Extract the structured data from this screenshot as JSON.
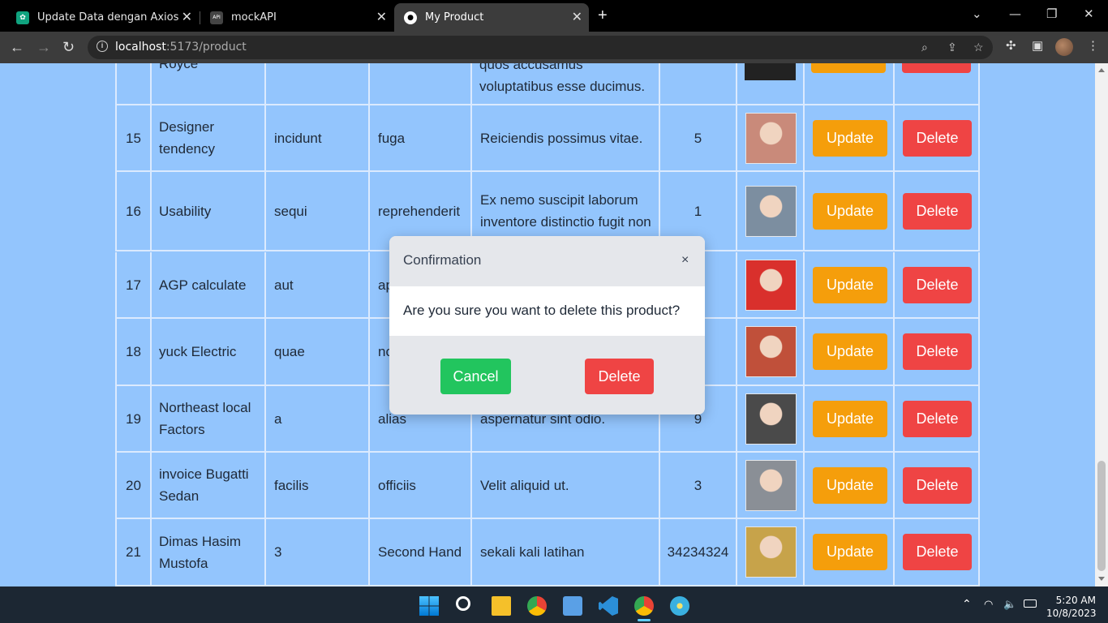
{
  "browser": {
    "tabs": [
      {
        "title": "Update Data dengan Axios",
        "icon": "chatgpt-icon"
      },
      {
        "title": "mockAPI",
        "icon": "mockapi-icon"
      },
      {
        "title": "My Product",
        "icon": "github-icon"
      }
    ],
    "url_host": "localhost",
    "url_path": ":5173/product"
  },
  "table": {
    "partial_row": {
      "name": "Royce",
      "description": "quos accusamus voluptatibus esse ducimus."
    },
    "rows": [
      {
        "id": "15",
        "name": "Designer tendency",
        "category": "incidunt",
        "freshness": "fuga",
        "description": "Reiciendis possimus vitae.",
        "price": "5",
        "image_color": "#c98a7a"
      },
      {
        "id": "16",
        "name": "Usability",
        "category": "sequi",
        "freshness": "reprehenderit",
        "description": "Ex nemo suscipit laborum inventore distinctio fugit non",
        "price": "1",
        "image_color": "#7c8ea0"
      },
      {
        "id": "17",
        "name": "AGP calculate",
        "category": "aut",
        "freshness": "ap",
        "description": "",
        "price": "",
        "image_color": "#d9302c"
      },
      {
        "id": "18",
        "name": "yuck Electric",
        "category": "quae",
        "freshness": "nc",
        "description": "",
        "price": "",
        "image_color": "#c0503a"
      },
      {
        "id": "19",
        "name": "Northeast local Factors",
        "category": "a",
        "freshness": "alias",
        "description": "aspernatur sint odio.",
        "price": "9",
        "image_color": "#4a4a4a"
      },
      {
        "id": "20",
        "name": "invoice Bugatti Sedan",
        "category": "facilis",
        "freshness": "officiis",
        "description": "Velit aliquid ut.",
        "price": "3",
        "image_color": "#8a8f96"
      },
      {
        "id": "21",
        "name": "Dimas Hasim Mustofa",
        "category": "3",
        "freshness": "Second Hand",
        "description": "sekali kali latihan",
        "price": "34234324",
        "image_color": "#c7a34a"
      }
    ],
    "update_label": "Update",
    "delete_label": "Delete"
  },
  "modal": {
    "title": "Confirmation",
    "close": "×",
    "message": "Are you sure you want to delete this product?",
    "cancel_label": "Cancel",
    "delete_label": "Delete"
  },
  "taskbar": {
    "apps": [
      "windows-start-icon",
      "search-icon",
      "file-explorer-icon",
      "chrome-icon",
      "notepad-icon",
      "vscode-icon",
      "chrome-profile-icon",
      "paint-icon"
    ],
    "time": "5:20 AM",
    "date": "10/8/2023"
  },
  "colors": {
    "page_bg": "#93c5fd",
    "update": "#f59e0b",
    "delete": "#ef4444",
    "cancel": "#22c55e"
  }
}
